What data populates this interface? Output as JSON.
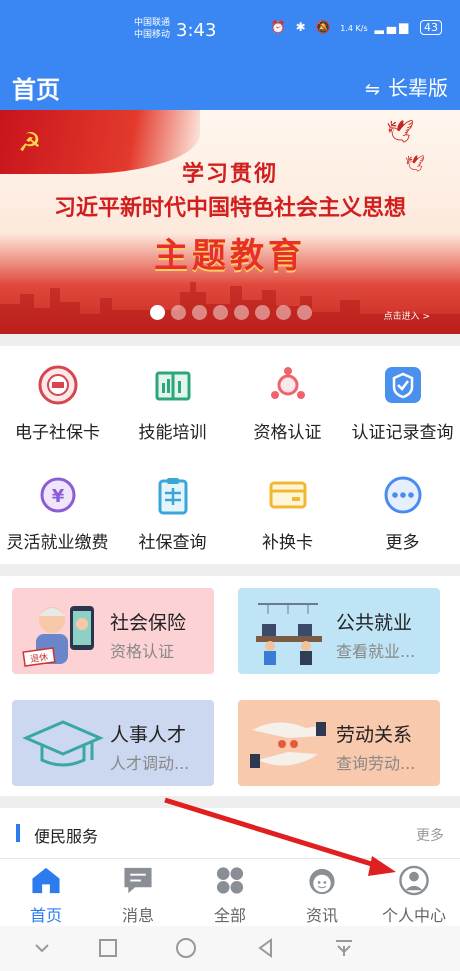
{
  "status_bar": {
    "carrier_1": "中国联通",
    "carrier_2": "中国移动",
    "time": "3:43",
    "net_speed": "1.4 K/s",
    "battery": "43"
  },
  "app_bar": {
    "title": "首页",
    "elder_mode": "长辈版"
  },
  "banner": {
    "line1": "学习贯彻",
    "line2": "习近平新时代中国特色社会主义思想",
    "line3": "主题教育",
    "enter_label": "点击进入 >",
    "slide_count": 8,
    "active_slide": 1
  },
  "grid": {
    "items": [
      {
        "label": "电子社保卡",
        "icon": "social-security-card-icon"
      },
      {
        "label": "技能培训",
        "icon": "training-book-icon"
      },
      {
        "label": "资格认证",
        "icon": "qualification-icon"
      },
      {
        "label": "认证记录查询",
        "icon": "certification-record-icon"
      },
      {
        "label": "灵活就业缴费",
        "icon": "yuan-payment-icon"
      },
      {
        "label": "社保查询",
        "icon": "clipboard-query-icon"
      },
      {
        "label": "补换卡",
        "icon": "card-replace-icon"
      },
      {
        "label": "更多",
        "icon": "more-dots-icon"
      }
    ]
  },
  "cards": [
    {
      "title": "社会保险",
      "subtitle": "资格认证",
      "color": "#fcd2d4",
      "badge": "退休"
    },
    {
      "title": "公共就业",
      "subtitle": "查看就业...",
      "color": "#bfe4f5"
    },
    {
      "title": "人事人才",
      "subtitle": "人才调动...",
      "color": "#cbd8f0"
    },
    {
      "title": "劳动关系",
      "subtitle": "查询劳动...",
      "color": "#f9c9ad"
    }
  ],
  "service": {
    "title": "便民服务",
    "more": "更多"
  },
  "bottom_nav": [
    {
      "label": "首页",
      "active": true
    },
    {
      "label": "消息",
      "active": false
    },
    {
      "label": "全部",
      "active": false
    },
    {
      "label": "资讯",
      "active": false
    },
    {
      "label": "个人中心",
      "active": false
    }
  ],
  "colors": {
    "primary": "#3a86f2",
    "active_nav": "#2c7cf0",
    "annotation_arrow": "#e02020"
  }
}
